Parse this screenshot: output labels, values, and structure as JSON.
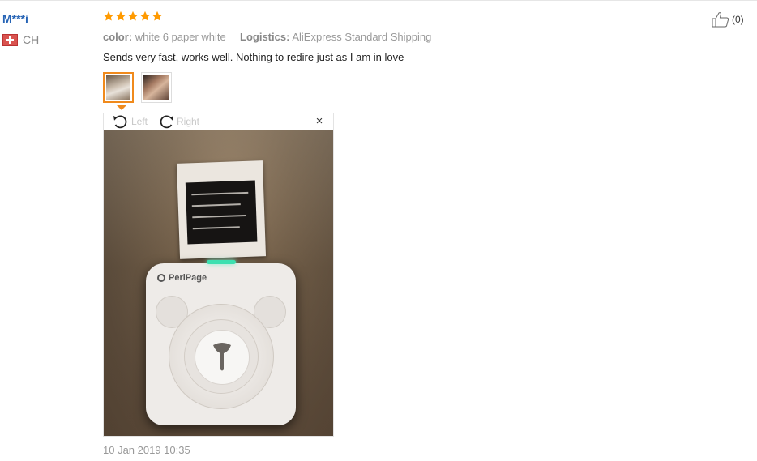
{
  "review": {
    "user": {
      "name": "M***i",
      "country_code": "CH"
    },
    "rating": 5,
    "meta": {
      "color_key": "color:",
      "color_value": "white 6 paper white",
      "logistics_key": "Logistics:",
      "logistics_value": "AliExpress Standard Shipping"
    },
    "text": "Sends very fast, works well. Nothing to redire just as I am in love",
    "viewer": {
      "rotate_left_label": "Left",
      "rotate_right_label": "Right",
      "close_label": "×"
    },
    "product_brand": "PeriPage",
    "date": "10 Jan 2019 10:35",
    "helpful_count": "(0)"
  },
  "colors": {
    "star": "#ff9a00",
    "accent": "#f08a1c",
    "username": "#2563b5"
  },
  "icons": [
    "flag-ch-icon",
    "star-icon",
    "rotate-left-icon",
    "rotate-right-icon",
    "close-icon",
    "thumbs-up-icon"
  ]
}
